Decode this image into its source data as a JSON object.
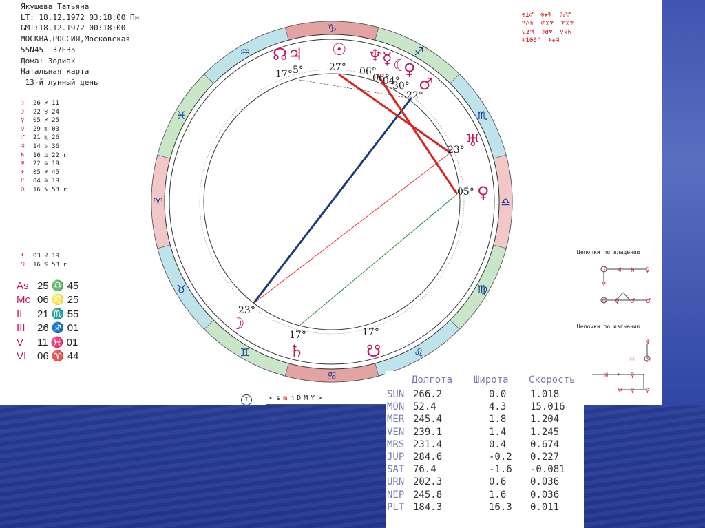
{
  "header": {
    "lines": [
      "Якушева Татьяна",
      "LT: 18.12.1972 03:18:00 Пн",
      "GMT:18.12.1972 00:18:00",
      "МОСКВА,РОССИЯ,Московская",
      "55N45  37E35",
      "Дома: Зодиак",
      "Натальная карта",
      " 13-й лунный день"
    ]
  },
  "planets": [
    {
      "glyph": "☉",
      "pos": "26 ♐ 11"
    },
    {
      "glyph": "☽",
      "pos": "22 ♉ 24"
    },
    {
      "glyph": "☿",
      "pos": "05 ♐ 25"
    },
    {
      "glyph": "♀",
      "pos": "29 ♏ 03"
    },
    {
      "glyph": "♂",
      "pos": "21 ♏ 26"
    },
    {
      "glyph": "♃",
      "pos": "14 ♑ 36"
    },
    {
      "glyph": "♄",
      "pos": "16 ♊ 22 r"
    },
    {
      "glyph": "♅",
      "pos": "22 ♎ 19"
    },
    {
      "glyph": "♆",
      "pos": "05 ♐ 45"
    },
    {
      "glyph": "♇",
      "pos": "04 ♎ 19"
    },
    {
      "glyph": "☊",
      "pos": "16 ♑ 53 r"
    }
  ],
  "planets2": [
    {
      "glyph": "⚸",
      "pos": "03 ♐ 19"
    },
    {
      "glyph": "☋",
      "pos": "16 ♋ 53 r"
    }
  ],
  "houses": [
    {
      "label": "As",
      "pos": "25 ♎ 45"
    },
    {
      "label": "Mc",
      "pos": "06 ♌ 25"
    },
    {
      "label": "II",
      "pos": "21 ♏ 55"
    },
    {
      "label": "III",
      "pos": "26 ♐ 01"
    },
    {
      "label": "V",
      "pos": "11 ♓ 01"
    },
    {
      "label": "VI",
      "pos": "06 ♈ 44"
    }
  ],
  "aspects_grid": [
    "⊙⊥♂  ⊙⚹♅  ☽☍♂",
    "♃⚻♄  ♂⚹♆  ♆⚹♅",
    "♀⊻♃  ☽☌♆  ♀⚹♄",
    "♅100°  ♆⚹♃"
  ],
  "chains": {
    "title1": "Цепочки по владению",
    "title2": "Цепочки по изгнанию"
  },
  "chart_labels": {
    "deg_27": "27°",
    "deg_17b": "17°",
    "deg_5": "5°",
    "deg_06": "06°",
    "deg_06b": "06°",
    "deg_04": "04°",
    "deg_30": "30°",
    "deg_22": "22°",
    "deg_23r": "23°",
    "deg_05r": "05°",
    "deg_23l": "23°",
    "deg_17l": "17°",
    "deg_17r": "17°",
    "zodiac": [
      "♑",
      "♐",
      "♏",
      "♎",
      "♍",
      "♌",
      "♋",
      "♊",
      "♉",
      "♈",
      "♓",
      "♒"
    ],
    "planet_glyphs": {
      "node": "☊",
      "jup": "♃",
      "sun": "☉",
      "nep": "♆",
      "mer": "☿",
      "moonb": "☾",
      "ven": "♀",
      "mars": "♂",
      "ura": "♅",
      "ven2": "♀",
      "moon": "☽",
      "sat": "♄",
      "node2": "☋"
    }
  },
  "toolbar": {
    "btn": "T",
    "items": [
      "<",
      "s",
      "m",
      "h",
      "D",
      "M",
      "Y",
      ">"
    ]
  },
  "table": {
    "headers": [
      "Долгота",
      "Широта",
      "Скорость"
    ],
    "rows": [
      {
        "name": "SUN",
        "lon": "266.2",
        "lat": "0.0",
        "spd": "1.018"
      },
      {
        "name": "MON",
        "lon": "52.4",
        "lat": "4.3",
        "spd": "15.016"
      },
      {
        "name": "MER",
        "lon": "245.4",
        "lat": "1.8",
        "spd": "1.204"
      },
      {
        "name": "VEN",
        "lon": "239.1",
        "lat": "1.4",
        "spd": "1.245"
      },
      {
        "name": "MRS",
        "lon": "231.4",
        "lat": "0.4",
        "spd": "0.674"
      },
      {
        "name": "JUP",
        "lon": "284.6",
        "lat": "-0.2",
        "spd": "0.227"
      },
      {
        "name": "SAT",
        "lon": "76.4",
        "lat": "-1.6",
        "spd": "-0.081"
      },
      {
        "name": "URN",
        "lon": "202.3",
        "lat": "0.6",
        "spd": "0.036"
      },
      {
        "name": "NEP",
        "lon": "245.8",
        "lat": "1.6",
        "spd": "0.036"
      },
      {
        "name": "PLT",
        "lon": "184.3",
        "lat": "16.3",
        "spd": "0.011"
      }
    ]
  }
}
